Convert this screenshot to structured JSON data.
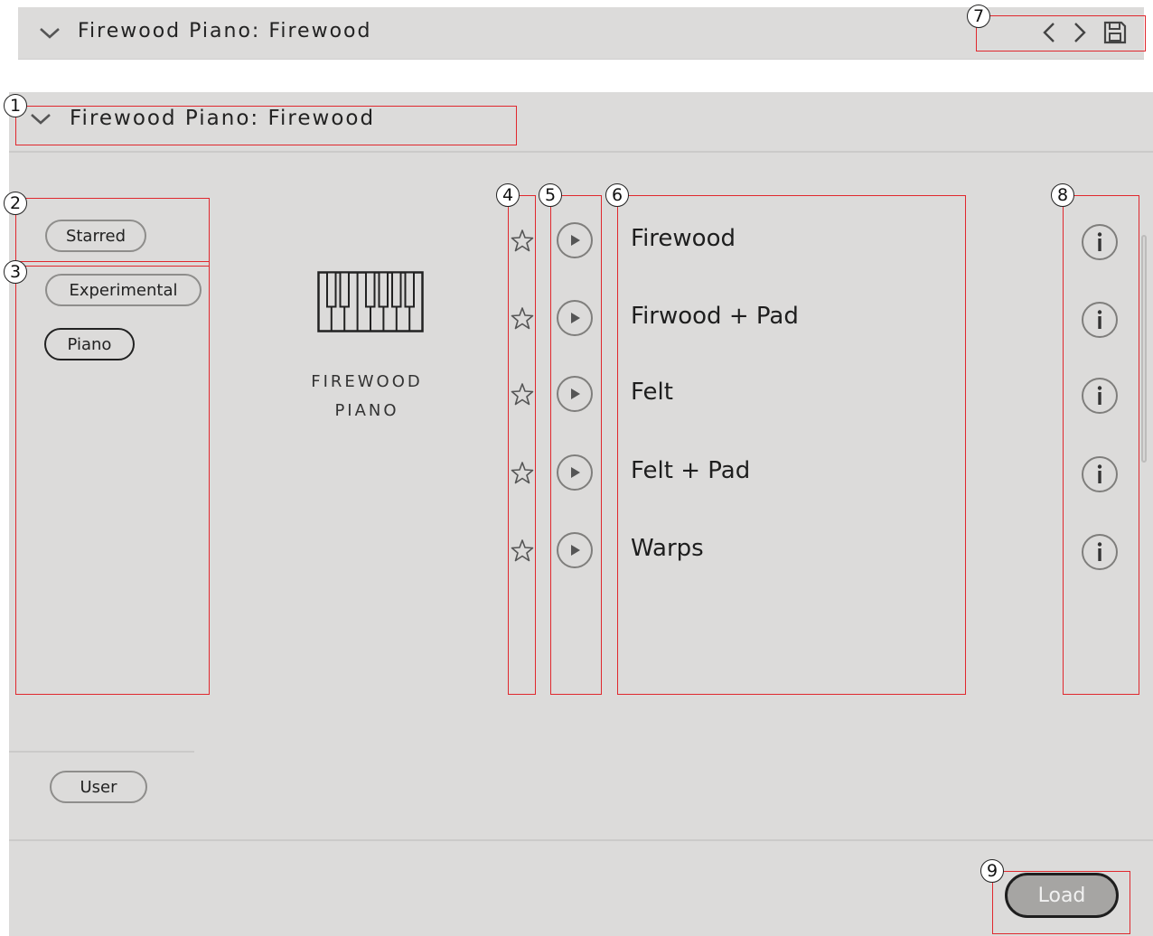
{
  "top_bar": {
    "title": "Firewood Piano: Firewood",
    "icons": [
      "chevron-down-icon",
      "chevron-left-icon",
      "chevron-right-icon",
      "save-icon"
    ]
  },
  "section": {
    "title": "Firewood Piano: Firewood"
  },
  "filters": {
    "starred": "Starred",
    "tags": [
      "Experimental",
      "Piano"
    ],
    "selected_tag": "Piano",
    "user": "User"
  },
  "instrument": {
    "icon": "piano-keys-icon",
    "name_line1": "FIREWOOD",
    "name_line2": "PIANO"
  },
  "presets": [
    {
      "name": "Firewood"
    },
    {
      "name": "Firwood + Pad"
    },
    {
      "name": "Felt"
    },
    {
      "name": "Felt + Pad"
    },
    {
      "name": "Warps"
    }
  ],
  "footer": {
    "load_label": "Load"
  },
  "callouts": [
    "1",
    "2",
    "3",
    "4",
    "5",
    "6",
    "7",
    "8",
    "9"
  ],
  "colors": {
    "panel_bg": "#dcdbda",
    "annotation": "#e0282e",
    "load_button_bg": "#a6a5a3"
  }
}
